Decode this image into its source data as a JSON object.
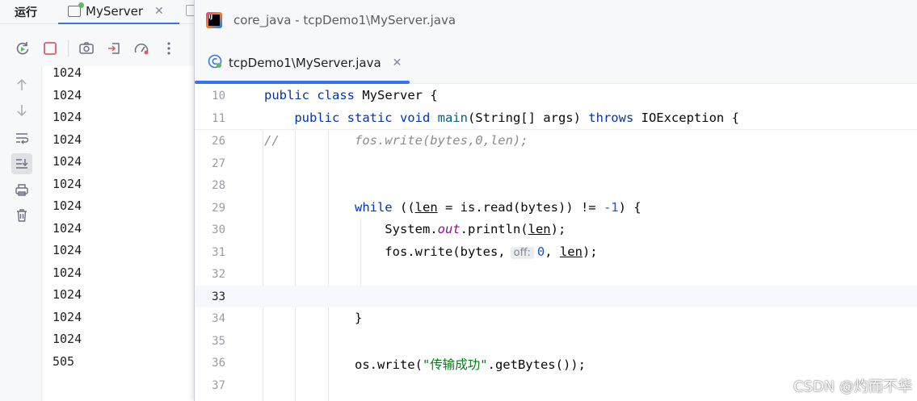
{
  "run_panel": {
    "title": "运行",
    "tab_label": "MyServer",
    "tab_close": "✕",
    "console_lines": [
      "1024",
      "1024",
      "1024",
      "1024",
      "1024",
      "1024",
      "1024",
      "1024",
      "1024",
      "1024",
      "1024",
      "1024",
      "1024",
      "505"
    ]
  },
  "editor": {
    "window_title": "core_java - tcpDemo1\\MyServer.java",
    "app_logo_text": "IJ",
    "tab_label": "tcpDemo1\\MyServer.java",
    "tab_close": "✕",
    "sticky_lines": [
      {
        "n": "10",
        "tokens": [
          [
            "kw",
            "public class "
          ],
          [
            "",
            "MyServer {"
          ]
        ]
      },
      {
        "n": "11",
        "tokens": [
          [
            "",
            "    "
          ],
          [
            "kw",
            "public static void "
          ],
          [
            "mth",
            "main"
          ],
          [
            "",
            "(String[] args) "
          ],
          [
            "kw",
            "throws "
          ],
          [
            "",
            "IOException {"
          ]
        ]
      }
    ],
    "lines": [
      {
        "n": "26",
        "tokens": [
          [
            "cmt",
            "//          fos.write(bytes,0,len);"
          ]
        ]
      },
      {
        "n": "27",
        "tokens": []
      },
      {
        "n": "28",
        "tokens": []
      },
      {
        "n": "29",
        "tokens": [
          [
            "",
            "            "
          ],
          [
            "kw",
            "while "
          ],
          [
            "",
            "(("
          ],
          [
            "ul",
            "len"
          ],
          [
            "",
            " = is.read(bytes)) != "
          ],
          [
            "num",
            "-1"
          ],
          [
            "",
            ") {"
          ]
        ]
      },
      {
        "n": "30",
        "tokens": [
          [
            "",
            "                System."
          ],
          [
            "stat",
            "out"
          ],
          [
            "",
            ".println("
          ],
          [
            "ul",
            "len"
          ],
          [
            "",
            ");"
          ]
        ]
      },
      {
        "n": "31",
        "tokens": [
          [
            "",
            "                fos.write(bytes,"
          ],
          [
            "hint",
            "off:"
          ],
          [
            "num",
            "0"
          ],
          [
            "",
            ", "
          ],
          [
            "ul",
            "len"
          ],
          [
            "",
            ");"
          ]
        ]
      },
      {
        "n": "32",
        "tokens": []
      },
      {
        "n": "33",
        "tokens": []
      },
      {
        "n": "34",
        "tokens": [
          [
            "",
            "            }"
          ]
        ]
      },
      {
        "n": "35",
        "tokens": []
      },
      {
        "n": "36",
        "tokens": [
          [
            "",
            "            os.write("
          ],
          [
            "str",
            "\"传输成功\""
          ],
          [
            "",
            ".getBytes());"
          ]
        ]
      },
      {
        "n": "37",
        "tokens": []
      }
    ],
    "caret_line": "33"
  },
  "watermark": "CSDN @灼而不华",
  "icons": [
    "rerun-icon",
    "stop-icon",
    "camera-icon",
    "login-icon",
    "gauge-icon",
    "more-icon",
    "arrow-up-icon",
    "arrow-down-icon",
    "soft-wrap-icon",
    "scroll-to-end-icon",
    "print-icon",
    "trash-icon",
    "intellij-logo-icon",
    "java-class-icon"
  ],
  "colors": {
    "accent": "#3574f0",
    "keyword": "#0033b3",
    "method": "#00627a",
    "string": "#067d17",
    "number": "#1750eb",
    "comment": "#8c8c8c"
  }
}
